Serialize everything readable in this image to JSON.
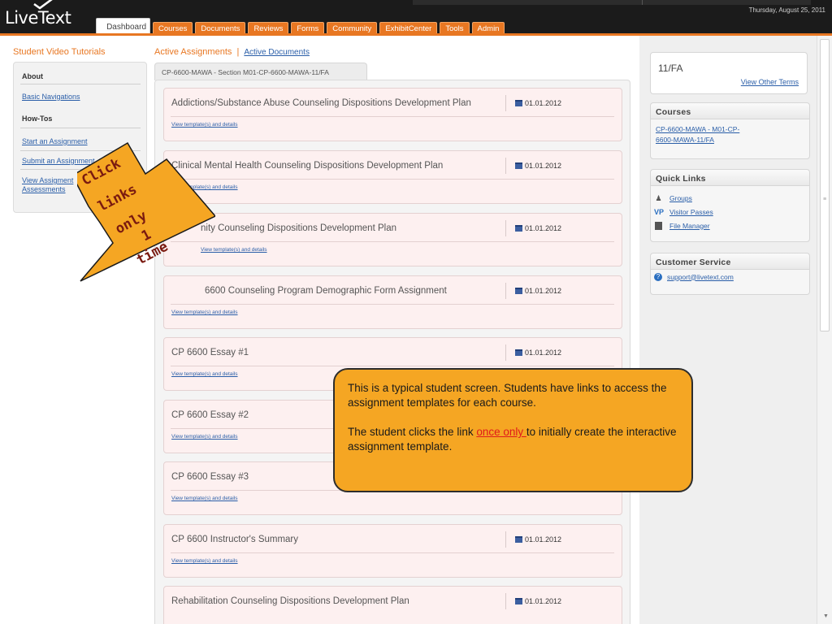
{
  "header": {
    "logo_text": "LiveText",
    "date": "Thursday, August 25, 2011",
    "tabs": [
      {
        "label": "Dashboard"
      },
      {
        "label": "Courses"
      },
      {
        "label": "Documents"
      },
      {
        "label": "Reviews"
      },
      {
        "label": "Forms"
      },
      {
        "label": "Community"
      },
      {
        "label": "ExhibitCenter"
      },
      {
        "label": "Tools"
      },
      {
        "label": "Admin"
      }
    ]
  },
  "sidebar": {
    "title": "Student Video Tutorials",
    "about_header": "About",
    "about_links": [
      "Basic Navigations"
    ],
    "howto_header": "How-Tos",
    "howto_links": [
      "Start an Assignment",
      "Submit an Assignment",
      "View Assigment",
      "Assessments"
    ]
  },
  "center": {
    "active_assignments": "Active Assignments",
    "separator": "|",
    "active_documents": "Active Documents",
    "course_tab": "CP-6600-MAWA - Section M01-CP-6600-MAWA-11/FA",
    "view_template_label": "View template(s) and details",
    "assignments": [
      {
        "title": "Addictions/Substance Abuse Counseling Dispositions Development Plan",
        "date": "01.01.2012"
      },
      {
        "title": "Clinical Mental Health Counseling Dispositions Development Plan",
        "date": "01.01.2012"
      },
      {
        "title": "nity Counseling Dispositions Development Plan",
        "date": "01.01.2012"
      },
      {
        "title": "6600 Counseling Program Demographic Form Assignment",
        "date": "01.01.2012"
      },
      {
        "title": "CP 6600 Essay #1",
        "date": "01.01.2012"
      },
      {
        "title": "CP 6600 Essay #2",
        "date": ""
      },
      {
        "title": "CP 6600 Essay #3",
        "date": ""
      },
      {
        "title": "CP 6600 Instructor's Summary",
        "date": "01.01.2012"
      },
      {
        "title": "Rehabilitation Counseling Dispositions Development Plan",
        "date": "01.01.2012"
      }
    ]
  },
  "right": {
    "term": "11/FA",
    "view_other_terms": "View Other Terms",
    "courses_header": "Courses",
    "course_link_1": "CP-6600-MAWA - M01-CP-",
    "course_link_2": "6600-MAWA-11/FA",
    "quick_links_header": "Quick Links",
    "quick_links": [
      {
        "label": "Groups",
        "icon": "groups-icon"
      },
      {
        "label": "Visitor Passes",
        "icon": "visitor-pass-icon"
      },
      {
        "label": "File Manager",
        "icon": "file-manager-icon"
      }
    ],
    "customer_service_header": "Customer Service",
    "support_email": "support@livetext.com"
  },
  "annotation": {
    "arrow_lines": [
      "Click",
      "links",
      "only",
      "1",
      "time"
    ],
    "arrow_color": "#f5a623",
    "callout_line1": "This is a typical student screen.  Students have links to access the assignment templates for each course.",
    "callout_line2_prefix": "The student clicks the link ",
    "callout_line2_highlight": "once only ",
    "callout_line2_suffix": "to initially create the  interactive assignment template."
  },
  "colors": {
    "accent": "#e87722",
    "link": "#2a5ea8",
    "card_bg": "#fdf0f0",
    "callout_bg": "#f5a623"
  }
}
